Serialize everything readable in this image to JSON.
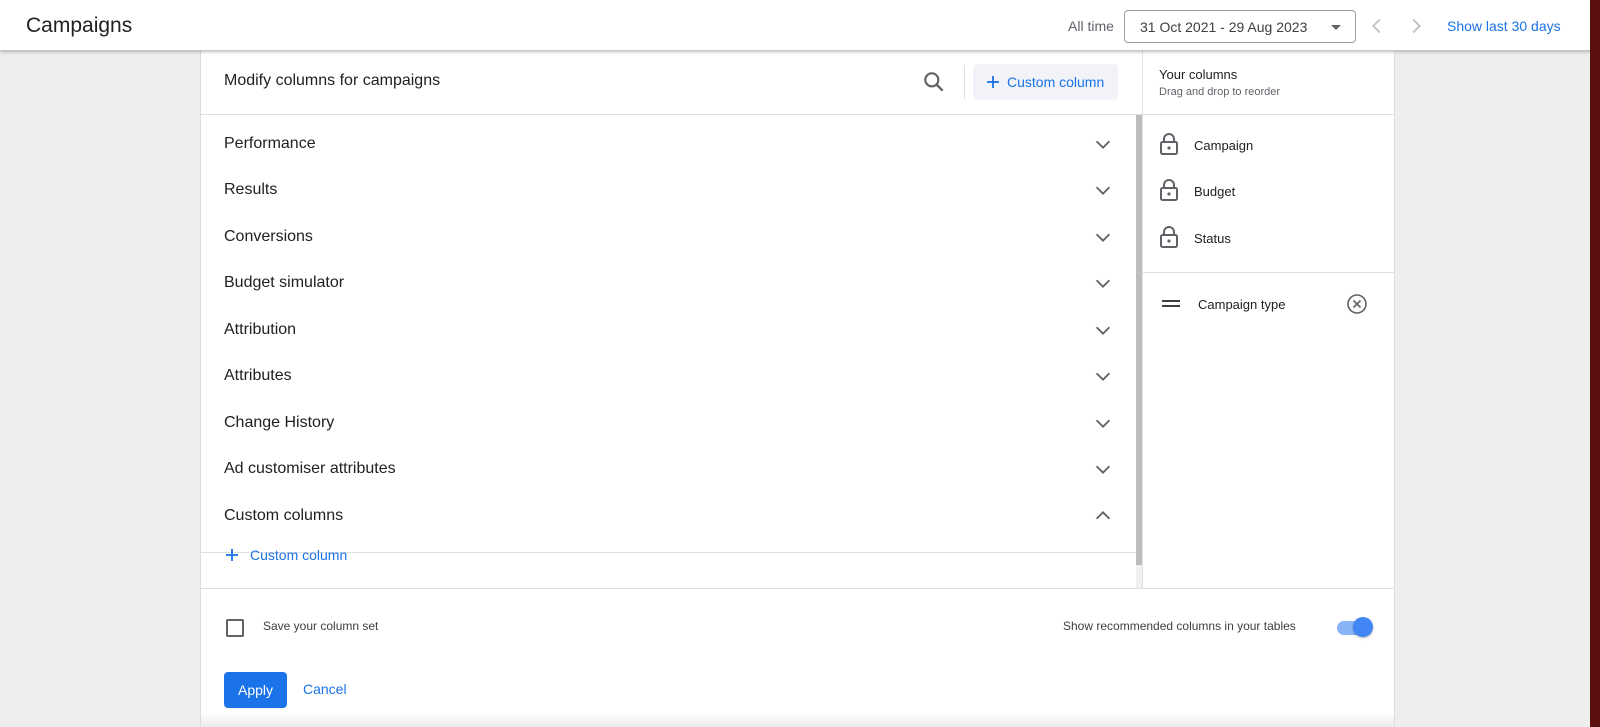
{
  "header": {
    "title": "Campaigns",
    "range_label": "All time",
    "date_range": "31 Oct 2021 - 29 Aug 2023",
    "show_last": "Show last 30 days",
    "icons": [
      "chevron-left-icon",
      "chevron-right-icon",
      "caret-down-icon"
    ]
  },
  "modify": {
    "title": "Modify columns for campaigns",
    "custom_column_button": "Custom column",
    "sections": [
      {
        "label": "Performance",
        "expanded": false
      },
      {
        "label": "Results",
        "expanded": false
      },
      {
        "label": "Conversions",
        "expanded": false
      },
      {
        "label": "Budget simulator",
        "expanded": false
      },
      {
        "label": "Attribution",
        "expanded": false
      },
      {
        "label": "Attributes",
        "expanded": false
      },
      {
        "label": "Change History",
        "expanded": false
      },
      {
        "label": "Ad customiser attributes",
        "expanded": false
      },
      {
        "label": "Custom columns",
        "expanded": true
      }
    ],
    "add_custom_column": "Custom column"
  },
  "your_columns": {
    "title": "Your columns",
    "subtitle": "Drag and drop to reorder",
    "locked": [
      "Campaign",
      "Budget",
      "Status"
    ],
    "movable": [
      "Campaign type"
    ]
  },
  "footer": {
    "save_set": "Save your column set",
    "save_set_checked": false,
    "show_recommended": "Show recommended columns in your tables",
    "show_recommended_on": true,
    "apply": "Apply",
    "cancel": "Cancel"
  },
  "colors": {
    "accent": "#1a73e8",
    "toggle_on": "#4285f4",
    "text": "#202124"
  }
}
